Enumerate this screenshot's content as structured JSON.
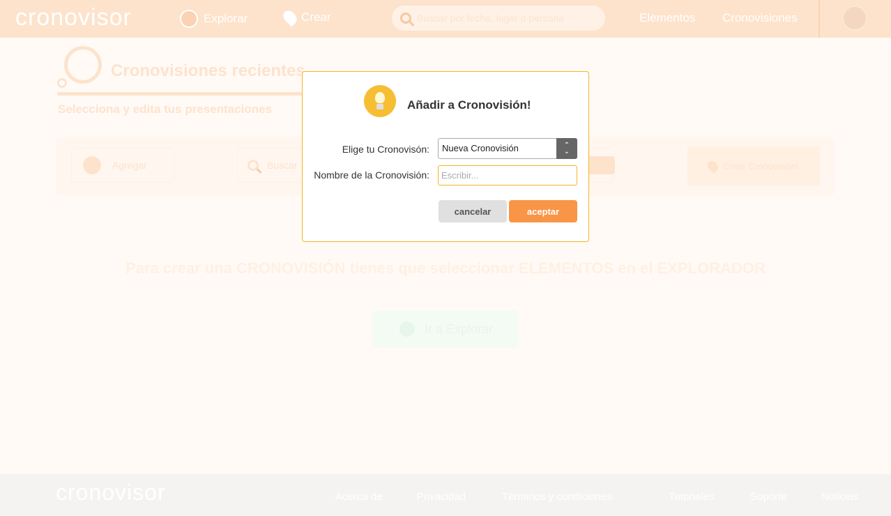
{
  "header": {
    "logo": "cronovisor",
    "nav": [
      {
        "label": "Explorar",
        "icon": "globe-icon"
      },
      {
        "label": "Crear",
        "icon": "map-pin-icon"
      }
    ],
    "search": {
      "placeholder": "Buscar por fecha, lugar o persona"
    },
    "links": [
      "Elementos",
      "Cronovisiones"
    ]
  },
  "page": {
    "title": "Cronovisiones recientes",
    "subtitle": "Selecciona y edita tus presentaciones",
    "toolbar": {
      "add_label": "Agregar",
      "search_placeholder": "Buscar",
      "create_label": "Crear Cronovisión!"
    },
    "empty_message": "Para crear una CRONOVISIÓN tienes que seleccionar ELEMENTOS en el EXPLORADOR",
    "explore_button": "Ir a Explorar"
  },
  "footer": {
    "logo": "cronovisor",
    "links": [
      "Acerca de",
      "Privacidad",
      "Términos y condiciones",
      "Tutoriales",
      "Soporte",
      "Noticias"
    ]
  },
  "modal": {
    "title": "Añadir a Cronovisión!",
    "select_label": "Elige tu Cronovisón:",
    "select_value": "Nueva Cronovisión",
    "name_label": "Nombre de la Cronovisión:",
    "name_placeholder": "Escribir...",
    "name_value": "",
    "cancel_label": "cancelar",
    "accept_label": "aceptar",
    "icon": "lightbulb-icon"
  },
  "colors": {
    "accent": "#f99546",
    "modal_border": "#f5b623",
    "header_bg": "#fde3cc"
  }
}
